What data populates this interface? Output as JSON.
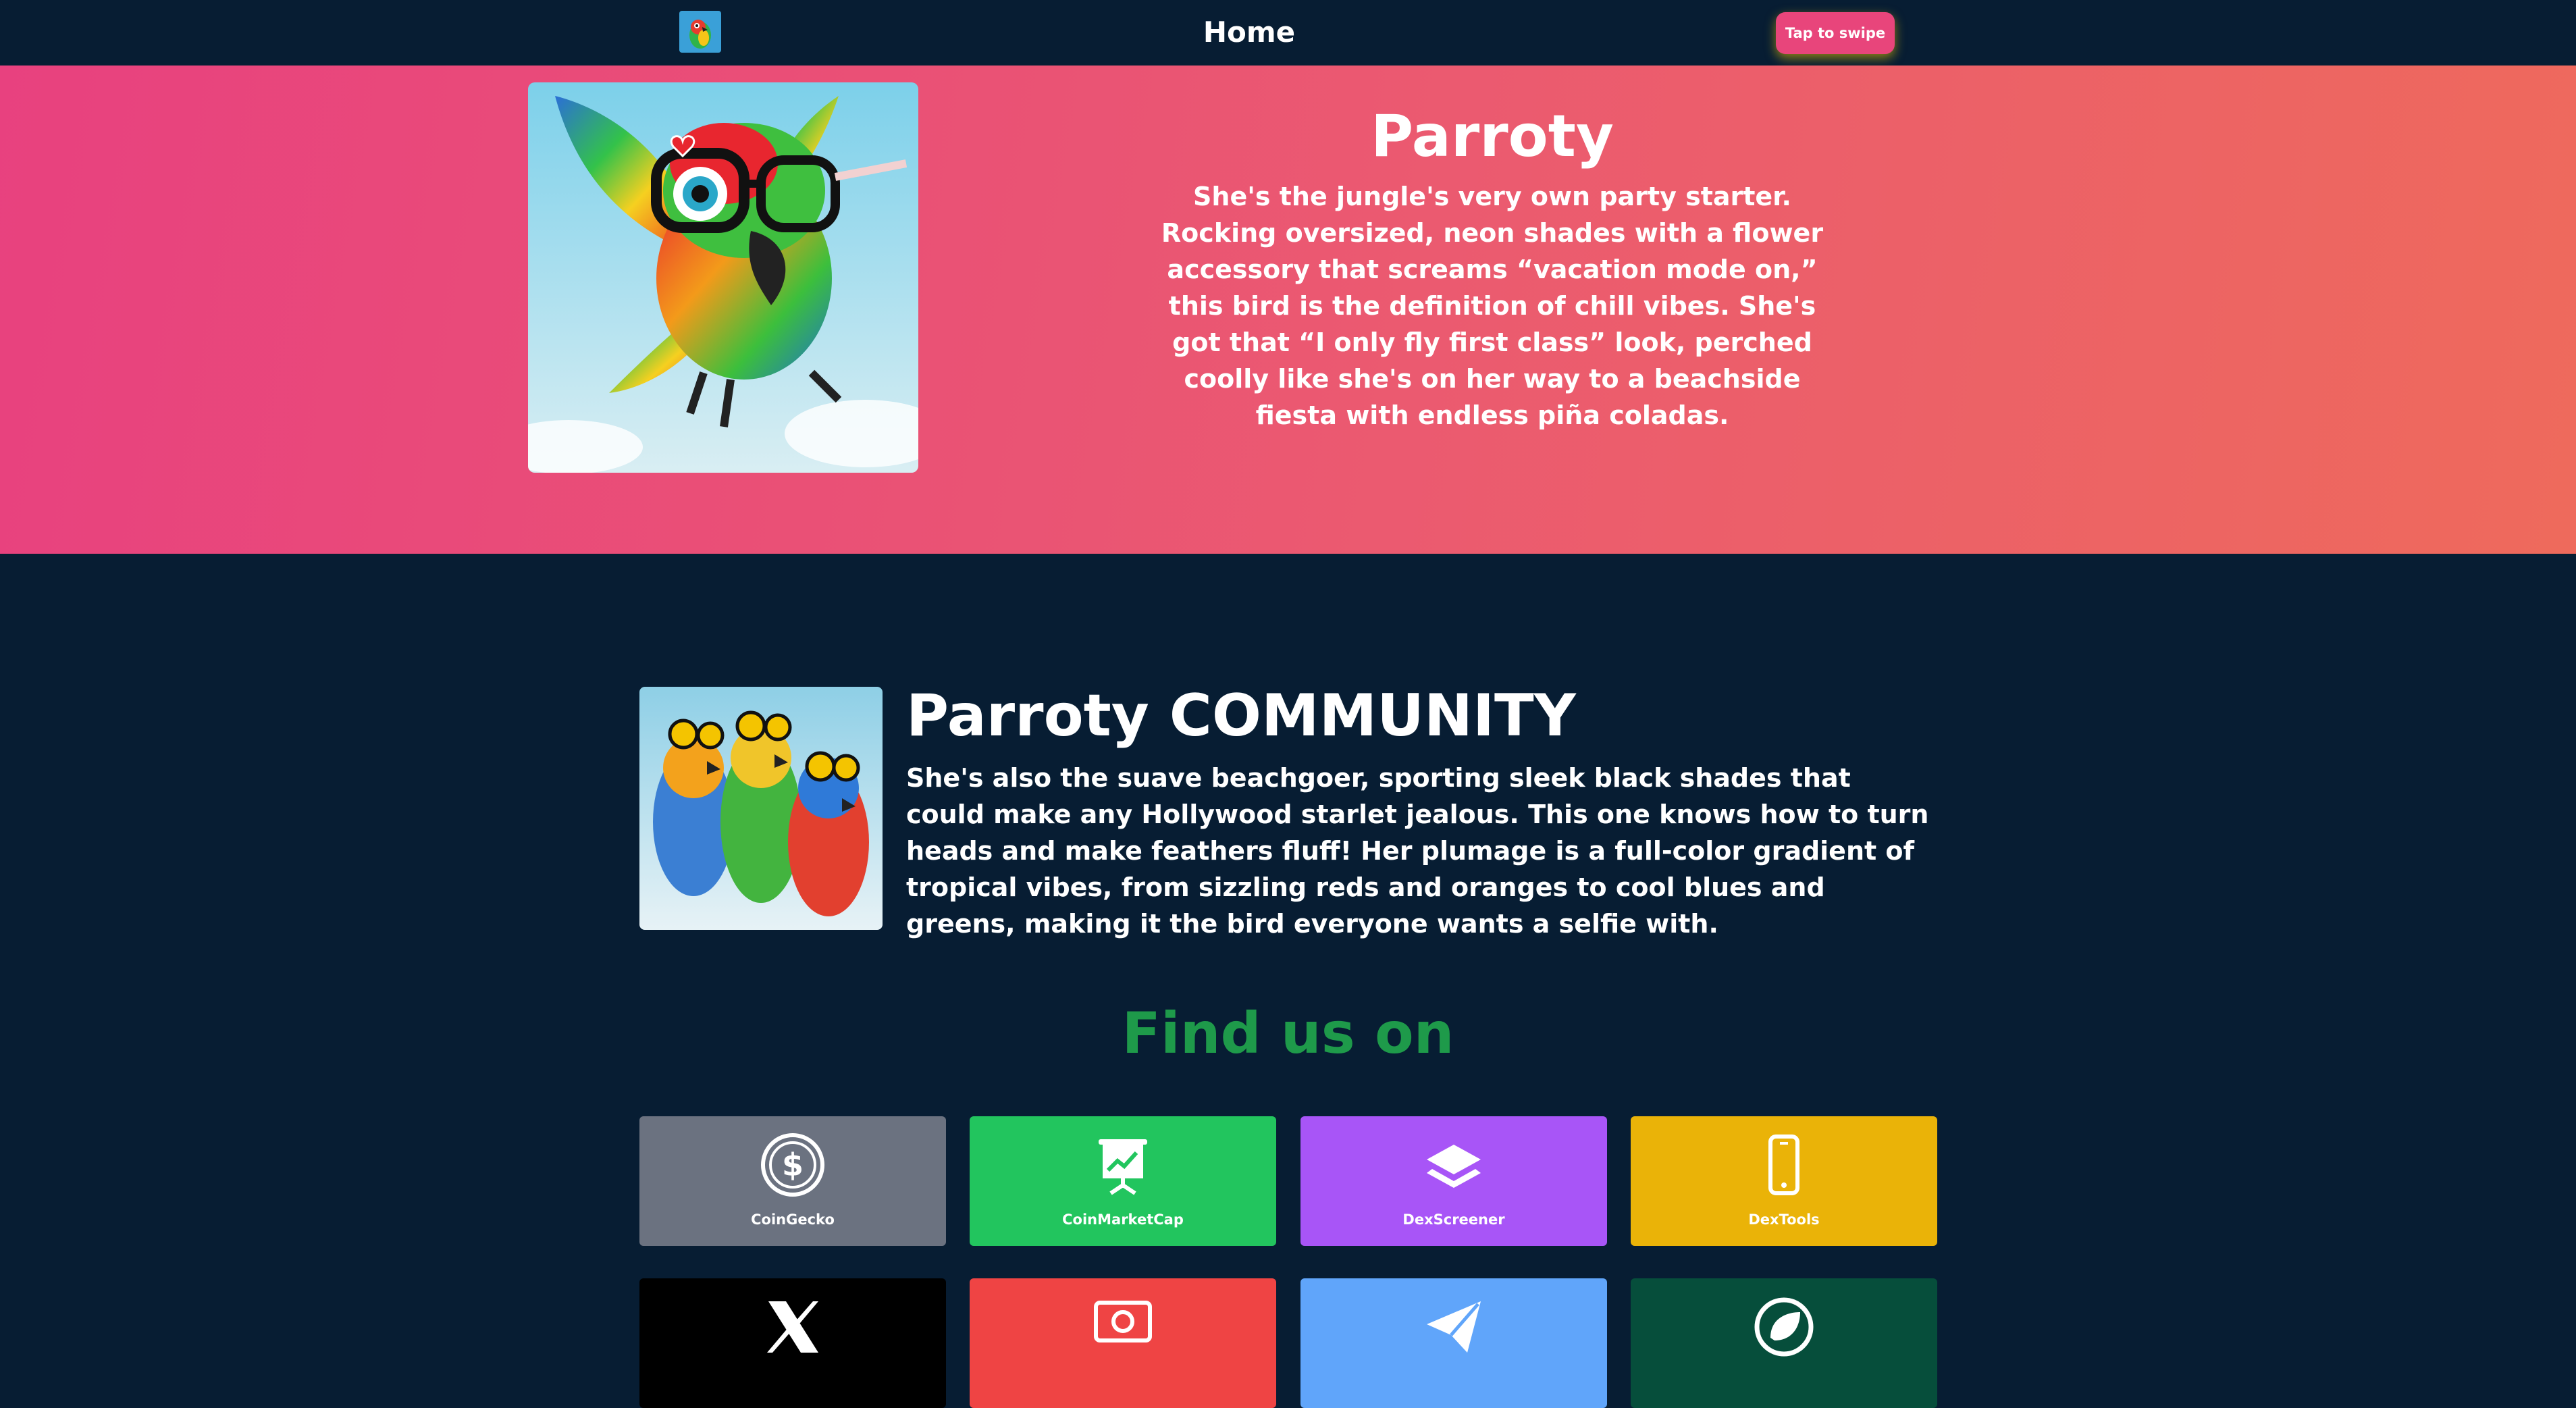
{
  "nav": {
    "title": "Home",
    "swipe_label": "Tap to swipe"
  },
  "hero": {
    "title": "Parroty",
    "description": "She's the jungle's very own party starter. Rocking oversized, neon shades with a flower accessory that screams “vacation mode on,” this bird is the definition of chill vibes. She's got that “I only fly first class” look, perched coolly like she's on her way to a beachside fiesta with endless piña coladas."
  },
  "community": {
    "title": "Parroty COMMUNITY",
    "description": "She's also the suave beachgoer, sporting sleek black shades that could make any Hollywood starlet jealous. This one knows how to turn heads and make feathers fluff! Her plumage is a full-color gradient of tropical vibes, from sizzling reds and oranges to cool blues and greens, making it the bird everyone wants a selfie with."
  },
  "find_us": {
    "title": "Find us on",
    "links": [
      {
        "label": "CoinGecko",
        "icon": "coin-icon",
        "color": "#6b7280"
      },
      {
        "label": "CoinMarketCap",
        "icon": "chart-board-icon",
        "color": "#22c55e"
      },
      {
        "label": "DexScreener",
        "icon": "layers-icon",
        "color": "#a855f7"
      },
      {
        "label": "DexTools",
        "icon": "phone-icon",
        "color": "#eab308"
      },
      {
        "label": "",
        "icon": "x-icon",
        "color": "#000000"
      },
      {
        "label": "",
        "icon": "cash-icon",
        "color": "#ef4444"
      },
      {
        "label": "",
        "icon": "telegram-icon",
        "color": "#60a5fa"
      },
      {
        "label": "",
        "icon": "leaf-icon",
        "color": "#064e3b"
      }
    ]
  },
  "colors": {
    "background": "#071d33",
    "hero_gradient_start": "#e8417f",
    "hero_gradient_end": "#ee6a5c",
    "accent_green": "#1e9a4a",
    "swipe_button": "#e8457b"
  }
}
